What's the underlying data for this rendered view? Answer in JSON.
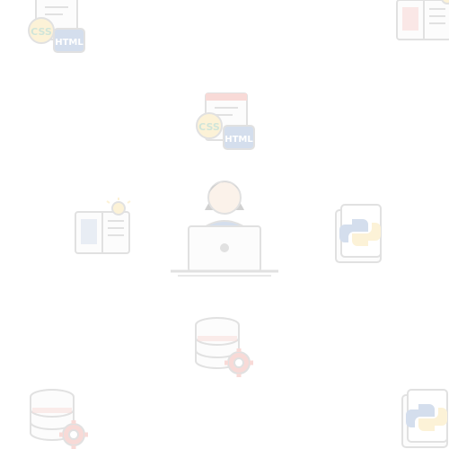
{
  "background": {
    "color": "#ffffff",
    "tint_opacity": 0.22
  },
  "labels": {
    "css": "CSS",
    "html": "HTML"
  },
  "icons": [
    {
      "id": "html-css-icon-top-left",
      "name": "html-css-file-icon"
    },
    {
      "id": "book-icon-top-right",
      "name": "open-book-icon"
    },
    {
      "id": "html-css-icon-center",
      "name": "html-css-file-icon"
    },
    {
      "id": "book-idea-icon-left",
      "name": "book-lightbulb-icon"
    },
    {
      "id": "developer-laptop-icon",
      "name": "developer-with-laptop-icon"
    },
    {
      "id": "python-file-icon-right",
      "name": "python-file-icon"
    },
    {
      "id": "database-gear-icon-center",
      "name": "database-gear-icon"
    },
    {
      "id": "database-gear-icon-bottom-left",
      "name": "database-gear-icon"
    },
    {
      "id": "python-file-icon-bottom-right",
      "name": "python-file-icon"
    }
  ],
  "colors": {
    "paper": "#f2f2f2",
    "outline": "#7a7a7a",
    "red": "#e35a4e",
    "green": "#2e8b57",
    "yellow": "#f6c94c",
    "blue": "#3f6fb0",
    "gray_dark": "#555555",
    "skin": "#f1c7a2",
    "hair": "#333333"
  }
}
